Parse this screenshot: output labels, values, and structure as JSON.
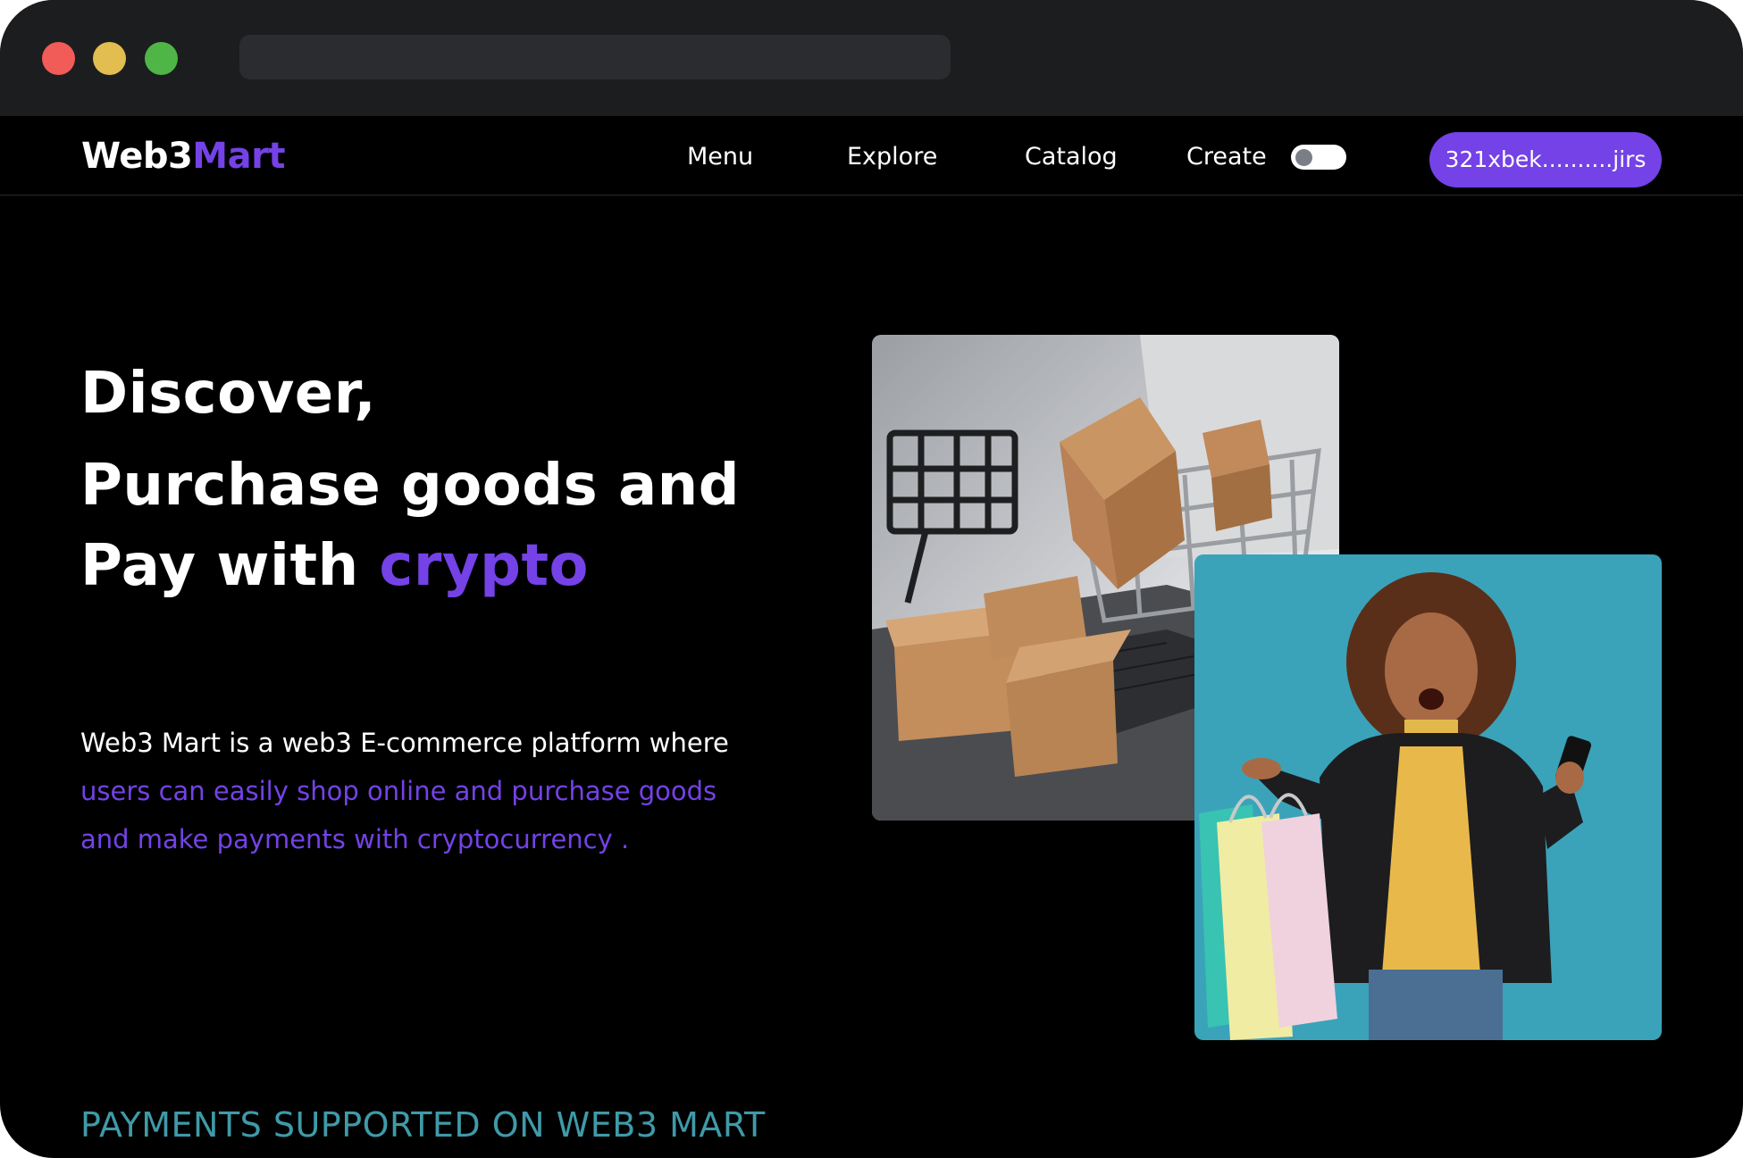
{
  "brand": {
    "name_part1": "Web3",
    "name_part2": "Mart"
  },
  "nav": {
    "items": [
      {
        "label": "Menu"
      },
      {
        "label": "Explore"
      },
      {
        "label": "Catalog"
      },
      {
        "label": "Create"
      }
    ],
    "wallet_address": "321xbek..........jirs"
  },
  "hero": {
    "line1": "Discover,",
    "line2": "Purchase goods and",
    "line3_prefix": "Pay with ",
    "line3_accent": "crypto"
  },
  "description": {
    "line1": "Web3 Mart is a web3 E-commerce platform where",
    "line2": "users can easily shop online and purchase goods",
    "line3": "and make payments with cryptocurrency ."
  },
  "payments_heading": "PAYMENTS SUPPORTED ON WEB3 MART",
  "colors": {
    "accent": "#7442e6",
    "teal": "#3f9aa8",
    "background": "#000000",
    "titlebar": "#1c1d1f"
  },
  "icons": {
    "toggle": "toggle-switch-icon"
  }
}
